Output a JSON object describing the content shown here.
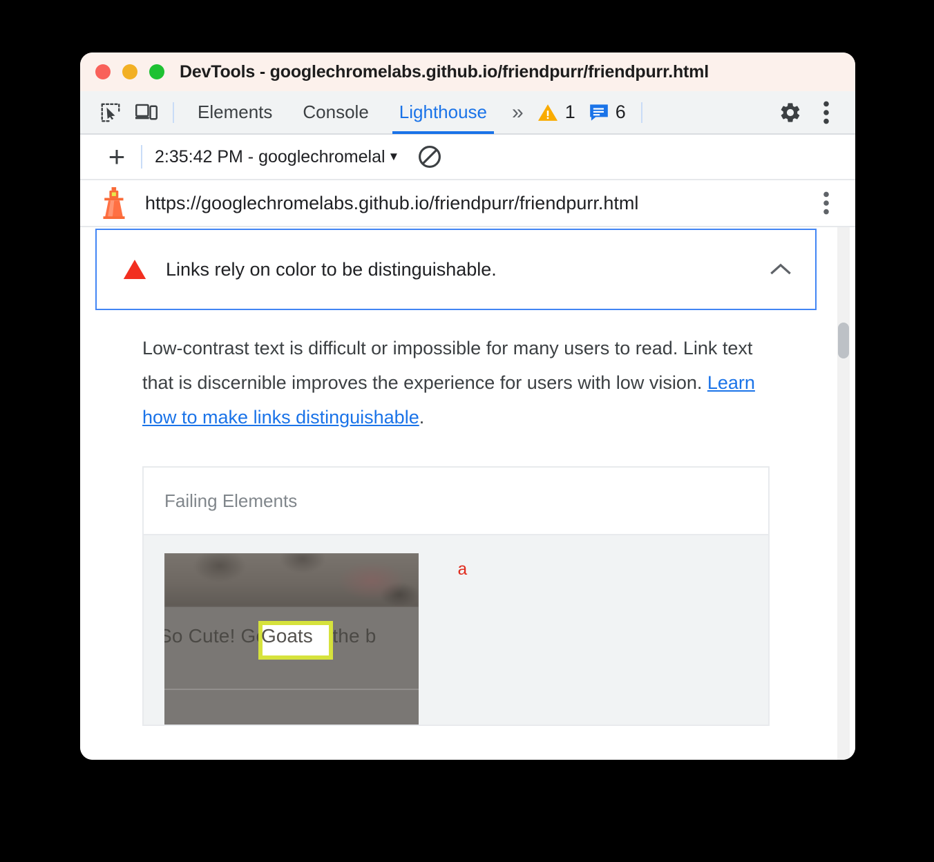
{
  "window": {
    "title": "DevTools - googlechromelabs.github.io/friendpurr/friendpurr.html",
    "traffic_lights": [
      "close",
      "minimize",
      "maximize"
    ],
    "colors": {
      "titlebar_bg": "#fcf1ec",
      "accent_blue": "#1a73e8",
      "warning_orange": "#f29900",
      "error_red": "#ea4335",
      "highlight_yellow": "#d6e23c"
    }
  },
  "devtools_tabs": {
    "icons": {
      "inspect": "inspect-element-icon",
      "device": "device-toolbar-icon"
    },
    "items": [
      {
        "label": "Elements",
        "active": false
      },
      {
        "label": "Console",
        "active": false
      },
      {
        "label": "Lighthouse",
        "active": true
      }
    ],
    "overflow_label": "»",
    "warning_count": "1",
    "message_count": "6",
    "settings_icon": "gear-icon",
    "more_icon": "kebab-menu-icon"
  },
  "lighthouse_toolbar": {
    "add_label": "+",
    "run_selected": "2:35:42 PM - googlechromelal",
    "dropdown_caret": "▼",
    "clear_icon": "clear-all-icon"
  },
  "url_bar": {
    "logo": "lighthouse-icon",
    "url": "https://googlechromelabs.github.io/friendpurr/friendpurr.html",
    "menu_icon": "kebab-menu-icon"
  },
  "audit": {
    "severity_icon": "red-triangle-fail-icon",
    "title": "Links rely on color to be distinguishable.",
    "collapse_icon": "chevron-up-icon",
    "description": {
      "before_link": "Low-contrast text is difficult or impossible for many users to read. Link text that is discernible improves the experience for users with low vision. ",
      "link_text": "Learn how to make links distinguishable",
      "after_link": "."
    },
    "failing_elements": {
      "header": "Failing Elements",
      "rows": [
        {
          "snippet_text": "So Cute! Goats are the b",
          "highlighted_word": "Goats",
          "selector": "a"
        }
      ]
    }
  },
  "scrollbar": {
    "position_label": "vertical-scrollbar"
  }
}
